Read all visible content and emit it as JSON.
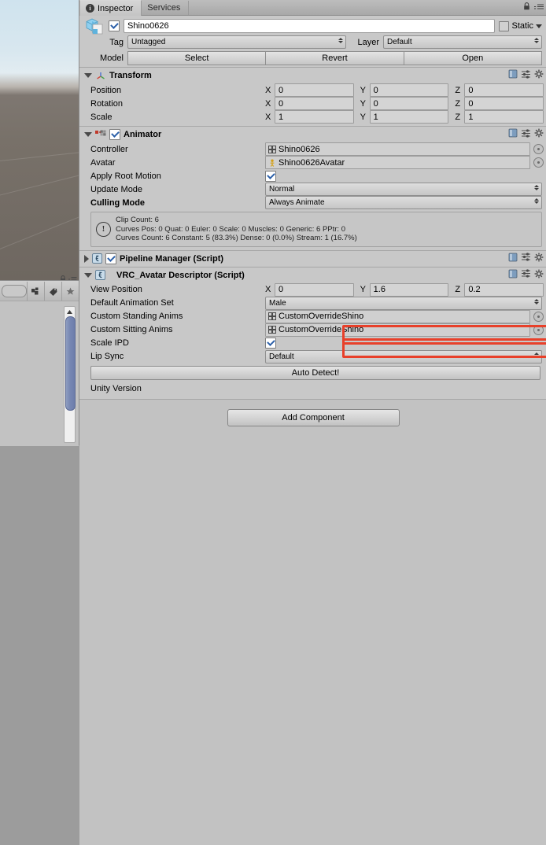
{
  "window": {
    "tabs": [
      {
        "label": "Inspector",
        "active": true,
        "icon": "info-icon"
      },
      {
        "label": "Services",
        "active": false,
        "icon": ""
      }
    ],
    "lock_icon": "lock-icon",
    "menu_icon": "hamburger-menu-icon"
  },
  "object_header": {
    "icon": "prefab-cube-icon",
    "enabled": true,
    "name": "Shino0626",
    "static_label": "Static",
    "static_checked": false,
    "tag_label": "Tag",
    "tag_value": "Untagged",
    "layer_label": "Layer",
    "layer_value": "Default",
    "model_label": "Model",
    "model_buttons": [
      "Select",
      "Revert",
      "Open"
    ]
  },
  "components": [
    {
      "id": "transform",
      "title": "Transform",
      "expanded": true,
      "has_checkbox": false,
      "icon": "transform-axis-icon",
      "rows": [
        {
          "label": "Position",
          "type": "vector3",
          "x": "0",
          "y": "0",
          "z": "0"
        },
        {
          "label": "Rotation",
          "type": "vector3",
          "x": "0",
          "y": "0",
          "z": "0"
        },
        {
          "label": "Scale",
          "type": "vector3",
          "x": "1",
          "y": "1",
          "z": "1"
        }
      ]
    },
    {
      "id": "animator",
      "title": "Animator",
      "expanded": true,
      "has_checkbox": true,
      "checked": true,
      "icon": "animator-icon",
      "rows": [
        {
          "label": "Controller",
          "type": "object",
          "value": "Shino0626",
          "icon": "animator-controller-icon"
        },
        {
          "label": "Avatar",
          "type": "object",
          "value": "Shino0626Avatar",
          "icon": "avatar-icon"
        },
        {
          "label": "Apply Root Motion",
          "type": "checkbox",
          "checked": true
        },
        {
          "label": "Update Mode",
          "type": "popup",
          "value": "Normal"
        },
        {
          "label": "Culling Mode",
          "type": "popup",
          "value": "Always Animate",
          "bold": true
        }
      ],
      "helpbox": {
        "icon": "warning-info-icon",
        "lines": [
          "Clip Count: 6",
          "Curves Pos: 0 Quat: 0 Euler: 0 Scale: 0 Muscles: 0 Generic: 6 PPtr: 0",
          "Curves Count: 6 Constant: 5 (83.3%) Dense: 0 (0.0%) Stream: 1 (16.7%)"
        ]
      }
    },
    {
      "id": "pipeline-manager",
      "title": "Pipeline Manager (Script)",
      "expanded": false,
      "has_checkbox": true,
      "checked": true,
      "icon": "script-icon",
      "rows": []
    },
    {
      "id": "vrc-avatar-descriptor",
      "title": "VRC_Avatar Descriptor (Script)",
      "expanded": true,
      "has_checkbox": false,
      "icon": "script-icon",
      "rows": [
        {
          "label": "View Position",
          "type": "vector3",
          "x": "0",
          "y": "1.6",
          "z": "0.2"
        },
        {
          "label": "Default Animation Set",
          "type": "popup",
          "value": "Male"
        },
        {
          "label": "Custom Standing Anims",
          "type": "object",
          "value": "CustomOverrideShino",
          "icon": "animator-override-icon",
          "highlighted": true
        },
        {
          "label": "Custom Sitting Anims",
          "type": "object",
          "value": "CustomOverrideShino",
          "icon": "animator-override-icon",
          "highlighted": true
        },
        {
          "label": "Scale IPD",
          "type": "checkbox",
          "checked": true
        },
        {
          "label": "Lip Sync",
          "type": "popup",
          "value": "Default"
        }
      ],
      "auto_detect_label": "Auto Detect!",
      "unity_version_label": "Unity Version"
    }
  ],
  "footer": {
    "add_component_label": "Add Component"
  },
  "left_panel": {
    "toolbar_icons": [
      "search-field",
      "material-paint-icon",
      "tag-label-icon",
      "favorite-star-icon"
    ],
    "top_icons": [
      "lock-icon",
      "hamburger-menu-icon"
    ],
    "scrollbar": "vertical-scrollbar"
  },
  "colors": {
    "highlight": "#e8402a",
    "panel_bg": "#c8c8c8",
    "field_bg": "#d4d4d4",
    "accent_check": "#2b5fa8"
  }
}
